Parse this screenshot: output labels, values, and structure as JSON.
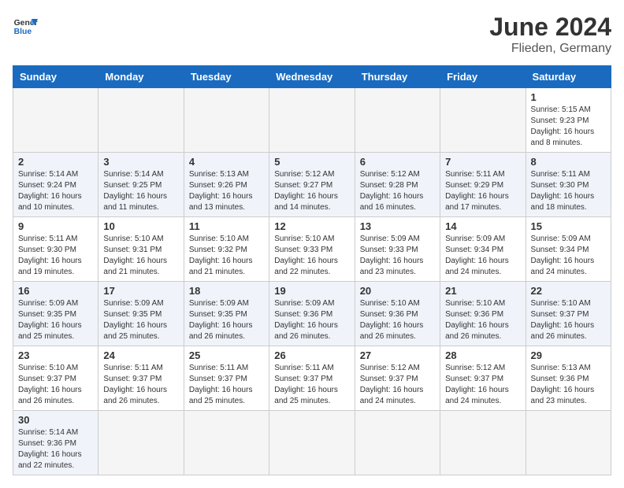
{
  "header": {
    "logo_general": "General",
    "logo_blue": "Blue",
    "month_year": "June 2024",
    "location": "Flieden, Germany"
  },
  "weekdays": [
    "Sunday",
    "Monday",
    "Tuesday",
    "Wednesday",
    "Thursday",
    "Friday",
    "Saturday"
  ],
  "weeks": [
    [
      {
        "day": "",
        "empty": true
      },
      {
        "day": "",
        "empty": true
      },
      {
        "day": "",
        "empty": true
      },
      {
        "day": "",
        "empty": true
      },
      {
        "day": "",
        "empty": true
      },
      {
        "day": "",
        "empty": true
      },
      {
        "day": "1",
        "sunrise": "Sunrise: 5:15 AM",
        "sunset": "Sunset: 9:23 PM",
        "daylight": "Daylight: 16 hours and 8 minutes."
      }
    ],
    [
      {
        "day": "2",
        "sunrise": "Sunrise: 5:14 AM",
        "sunset": "Sunset: 9:24 PM",
        "daylight": "Daylight: 16 hours and 10 minutes."
      },
      {
        "day": "3",
        "sunrise": "Sunrise: 5:14 AM",
        "sunset": "Sunset: 9:25 PM",
        "daylight": "Daylight: 16 hours and 11 minutes."
      },
      {
        "day": "4",
        "sunrise": "Sunrise: 5:13 AM",
        "sunset": "Sunset: 9:26 PM",
        "daylight": "Daylight: 16 hours and 13 minutes."
      },
      {
        "day": "5",
        "sunrise": "Sunrise: 5:12 AM",
        "sunset": "Sunset: 9:27 PM",
        "daylight": "Daylight: 16 hours and 14 minutes."
      },
      {
        "day": "6",
        "sunrise": "Sunrise: 5:12 AM",
        "sunset": "Sunset: 9:28 PM",
        "daylight": "Daylight: 16 hours and 16 minutes."
      },
      {
        "day": "7",
        "sunrise": "Sunrise: 5:11 AM",
        "sunset": "Sunset: 9:29 PM",
        "daylight": "Daylight: 16 hours and 17 minutes."
      },
      {
        "day": "8",
        "sunrise": "Sunrise: 5:11 AM",
        "sunset": "Sunset: 9:30 PM",
        "daylight": "Daylight: 16 hours and 18 minutes."
      }
    ],
    [
      {
        "day": "9",
        "sunrise": "Sunrise: 5:11 AM",
        "sunset": "Sunset: 9:30 PM",
        "daylight": "Daylight: 16 hours and 19 minutes."
      },
      {
        "day": "10",
        "sunrise": "Sunrise: 5:10 AM",
        "sunset": "Sunset: 9:31 PM",
        "daylight": "Daylight: 16 hours and 21 minutes."
      },
      {
        "day": "11",
        "sunrise": "Sunrise: 5:10 AM",
        "sunset": "Sunset: 9:32 PM",
        "daylight": "Daylight: 16 hours and 21 minutes."
      },
      {
        "day": "12",
        "sunrise": "Sunrise: 5:10 AM",
        "sunset": "Sunset: 9:33 PM",
        "daylight": "Daylight: 16 hours and 22 minutes."
      },
      {
        "day": "13",
        "sunrise": "Sunrise: 5:09 AM",
        "sunset": "Sunset: 9:33 PM",
        "daylight": "Daylight: 16 hours and 23 minutes."
      },
      {
        "day": "14",
        "sunrise": "Sunrise: 5:09 AM",
        "sunset": "Sunset: 9:34 PM",
        "daylight": "Daylight: 16 hours and 24 minutes."
      },
      {
        "day": "15",
        "sunrise": "Sunrise: 5:09 AM",
        "sunset": "Sunset: 9:34 PM",
        "daylight": "Daylight: 16 hours and 24 minutes."
      }
    ],
    [
      {
        "day": "16",
        "sunrise": "Sunrise: 5:09 AM",
        "sunset": "Sunset: 9:35 PM",
        "daylight": "Daylight: 16 hours and 25 minutes."
      },
      {
        "day": "17",
        "sunrise": "Sunrise: 5:09 AM",
        "sunset": "Sunset: 9:35 PM",
        "daylight": "Daylight: 16 hours and 25 minutes."
      },
      {
        "day": "18",
        "sunrise": "Sunrise: 5:09 AM",
        "sunset": "Sunset: 9:35 PM",
        "daylight": "Daylight: 16 hours and 26 minutes."
      },
      {
        "day": "19",
        "sunrise": "Sunrise: 5:09 AM",
        "sunset": "Sunset: 9:36 PM",
        "daylight": "Daylight: 16 hours and 26 minutes."
      },
      {
        "day": "20",
        "sunrise": "Sunrise: 5:10 AM",
        "sunset": "Sunset: 9:36 PM",
        "daylight": "Daylight: 16 hours and 26 minutes."
      },
      {
        "day": "21",
        "sunrise": "Sunrise: 5:10 AM",
        "sunset": "Sunset: 9:36 PM",
        "daylight": "Daylight: 16 hours and 26 minutes."
      },
      {
        "day": "22",
        "sunrise": "Sunrise: 5:10 AM",
        "sunset": "Sunset: 9:37 PM",
        "daylight": "Daylight: 16 hours and 26 minutes."
      }
    ],
    [
      {
        "day": "23",
        "sunrise": "Sunrise: 5:10 AM",
        "sunset": "Sunset: 9:37 PM",
        "daylight": "Daylight: 16 hours and 26 minutes."
      },
      {
        "day": "24",
        "sunrise": "Sunrise: 5:11 AM",
        "sunset": "Sunset: 9:37 PM",
        "daylight": "Daylight: 16 hours and 26 minutes."
      },
      {
        "day": "25",
        "sunrise": "Sunrise: 5:11 AM",
        "sunset": "Sunset: 9:37 PM",
        "daylight": "Daylight: 16 hours and 25 minutes."
      },
      {
        "day": "26",
        "sunrise": "Sunrise: 5:11 AM",
        "sunset": "Sunset: 9:37 PM",
        "daylight": "Daylight: 16 hours and 25 minutes."
      },
      {
        "day": "27",
        "sunrise": "Sunrise: 5:12 AM",
        "sunset": "Sunset: 9:37 PM",
        "daylight": "Daylight: 16 hours and 24 minutes."
      },
      {
        "day": "28",
        "sunrise": "Sunrise: 5:12 AM",
        "sunset": "Sunset: 9:37 PM",
        "daylight": "Daylight: 16 hours and 24 minutes."
      },
      {
        "day": "29",
        "sunrise": "Sunrise: 5:13 AM",
        "sunset": "Sunset: 9:36 PM",
        "daylight": "Daylight: 16 hours and 23 minutes."
      }
    ],
    [
      {
        "day": "30",
        "sunrise": "Sunrise: 5:14 AM",
        "sunset": "Sunset: 9:36 PM",
        "daylight": "Daylight: 16 hours and 22 minutes."
      },
      {
        "day": "",
        "empty": true
      },
      {
        "day": "",
        "empty": true
      },
      {
        "day": "",
        "empty": true
      },
      {
        "day": "",
        "empty": true
      },
      {
        "day": "",
        "empty": true
      },
      {
        "day": "",
        "empty": true
      }
    ]
  ]
}
